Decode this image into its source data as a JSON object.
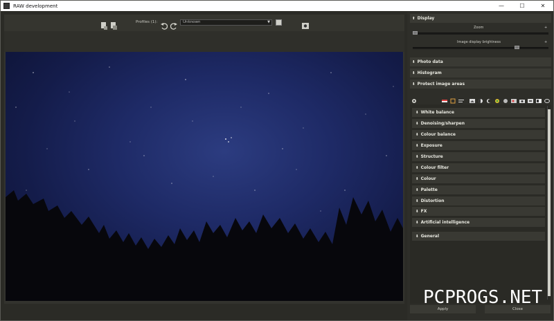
{
  "window": {
    "title": "RAW development",
    "controls": {
      "minimize": "—",
      "maximize": "☐",
      "close": "✕"
    }
  },
  "toolbar": {
    "profiles_label": "Profiles (1):",
    "profile_value": "Unknown",
    "icons": [
      "add-file-icon",
      "save-file-icon",
      "undo-icon",
      "redo-icon",
      "menu-icon",
      "snapshot-icon"
    ]
  },
  "right_panel": {
    "display": {
      "title": "Display",
      "zoom_label": "Zoom",
      "brightness_label": "Image display brightness",
      "zoom_value": 0.0,
      "brightness_value": 0.78
    },
    "sections": [
      {
        "label": "Photo data"
      },
      {
        "label": "Histogram"
      },
      {
        "label": "Protect image areas"
      }
    ],
    "adjustments": [
      {
        "label": "White balance"
      },
      {
        "label": "Denoising/sharpen"
      },
      {
        "label": "Colour balance"
      },
      {
        "label": "Exposure"
      },
      {
        "label": "Structure"
      },
      {
        "label": "Colour filter"
      },
      {
        "label": "Colour"
      },
      {
        "label": "Palette"
      },
      {
        "label": "Distortion"
      },
      {
        "label": "FX"
      },
      {
        "label": "Artificial intelligence"
      },
      {
        "label": "General"
      }
    ],
    "apply_label": "Apply",
    "close_label": "Close"
  },
  "watermark": "PCPROGS.NET",
  "colors": {
    "background": "#2b2b26",
    "panel_header": "#3a3a34",
    "sky": "#1e2a66"
  }
}
